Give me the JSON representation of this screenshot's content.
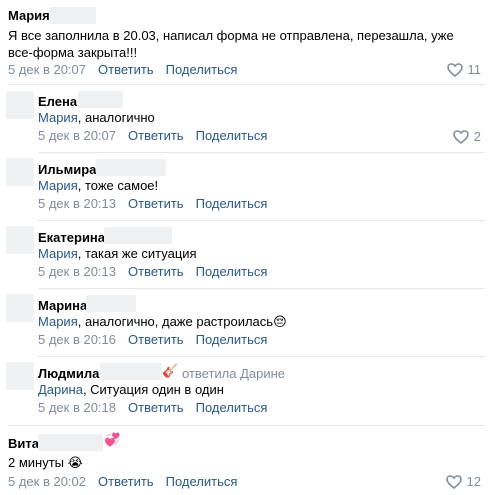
{
  "comments": [
    {
      "author": "Мария",
      "text": "Я все заполнила в 20.03, написал форма не отправлена, перезашла, уже все-форма закрыта!!!",
      "date": "5 дек в 20:07",
      "reply_label": "Ответить",
      "share_label": "Поделиться",
      "likes": "11",
      "avatar": "none"
    }
  ],
  "replies": [
    {
      "author": "Елена",
      "mention": "Мария",
      "text": ", аналогично",
      "date": "5 дек в 20:07",
      "reply_label": "Ответить",
      "share_label": "Поделиться",
      "likes": "2"
    },
    {
      "author": "Ильмира",
      "mention": "Мария",
      "text": ", тоже самое!",
      "date": "5 дек в 20:13",
      "reply_label": "Ответить",
      "share_label": "Поделиться"
    },
    {
      "author": "Екатерина",
      "mention": "Мария",
      "text": ", такая же ситуация",
      "date": "5 дек в 20:13",
      "reply_label": "Ответить",
      "share_label": "Поделиться"
    },
    {
      "author": "Марина",
      "mention": "Мария",
      "text": ", аналогично, даже растроилась",
      "emoji": "😔",
      "date": "5 дек в 20:16",
      "reply_label": "Ответить",
      "share_label": "Поделиться"
    },
    {
      "author": "Людмила",
      "author_emoji": "🎸",
      "replied_to": "ответила Дарине",
      "mention": "Дарина",
      "text": ", Ситуация один в один",
      "date": "5 дек в 20:18",
      "reply_label": "Ответить",
      "share_label": "Поделиться"
    }
  ],
  "last_comment": {
    "author": "Вита",
    "author_emoji": "💞",
    "text": "2 минуты",
    "emoji": "😭",
    "date": "5 дек в 20:02",
    "reply_label": "Ответить",
    "share_label": "Поделиться",
    "likes": "12"
  },
  "colors": {
    "link": "#2a5885",
    "meta": "#818c99",
    "text": "#000000",
    "divider": "#e7e8ec"
  },
  "icons": {
    "like": "heart-outline-icon"
  }
}
